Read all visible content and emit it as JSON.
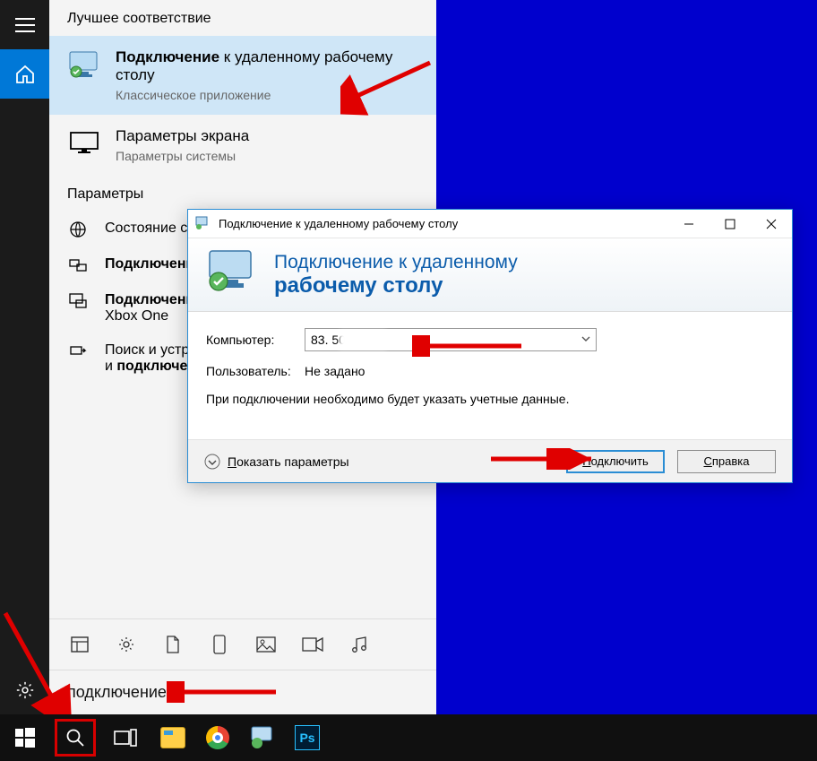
{
  "start": {
    "best_match_heading": "Лучшее соответствие",
    "rdp_result": {
      "prefix": "Подключение",
      "rest": " к удаленному рабочему столу",
      "sub": "Классическое приложение"
    },
    "display_result": {
      "title": "Параметры экрана",
      "sub": "Параметры системы"
    },
    "settings_heading": "Параметры",
    "settings": [
      "Состояние сети",
      "Подключение",
      "Подключение\nXbox One",
      "Поиск и устранение\nи подключени"
    ],
    "filters": [
      "grid",
      "gear",
      "document",
      "phone",
      "image",
      "video",
      "music"
    ],
    "search_query": "подключение"
  },
  "rdp": {
    "window_title": "Подключение к удаленному рабочему столу",
    "banner_line1": "Подключение к удаленному",
    "banner_line2": "рабочему столу",
    "computer_label": "Компьютер:",
    "computer_value": "83.                  50",
    "user_label": "Пользователь:",
    "user_value": "Не задано",
    "note": "При подключении необходимо будет указать учетные данные.",
    "show_options": "Показать параметры",
    "connect": "Подключить",
    "help": "Справка"
  },
  "taskbar": {
    "apps": [
      "explorer",
      "chrome",
      "rdp",
      "photoshop"
    ]
  }
}
